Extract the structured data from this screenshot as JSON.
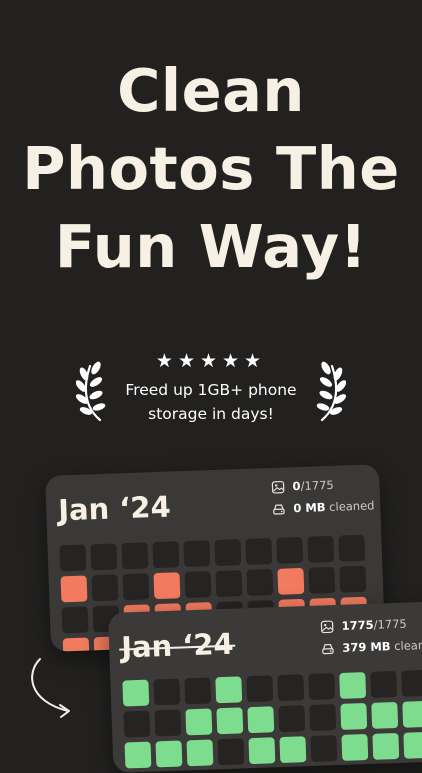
{
  "headline": {
    "line1": "Clean",
    "line2": "Photos The",
    "line3": "Fun Way!"
  },
  "award": {
    "stars": "★★★★★",
    "tagline": "Freed up 1GB+ phone storage in days!",
    "left_icon": "laurel-icon",
    "right_icon": "laurel-icon"
  },
  "card_before": {
    "month": "Jan ‘24",
    "photos_count": "0",
    "photos_total": "/1775",
    "cleaned_value": "0 MB",
    "cleaned_label": "cleaned",
    "grid_active": [
      0,
      0,
      0,
      0,
      0,
      0,
      0,
      0,
      0,
      0,
      1,
      0,
      0,
      1,
      0,
      0,
      0,
      1,
      0,
      0,
      0,
      0,
      1,
      1,
      1,
      0,
      0,
      1,
      1,
      1,
      1,
      1,
      1,
      0,
      1,
      1,
      0,
      1,
      1,
      1
    ],
    "accent": "#f27a5e"
  },
  "card_after": {
    "month": "Jan ‘24",
    "photos_count": "1775",
    "photos_total": "/1775",
    "cleaned_value": "379 MB",
    "cleaned_label": "cleaned",
    "grid_active": [
      1,
      0,
      0,
      1,
      0,
      0,
      0,
      1,
      0,
      0,
      0,
      0,
      1,
      1,
      1,
      0,
      0,
      1,
      1,
      1,
      1,
      1,
      1,
      0,
      1,
      1,
      0,
      1,
      1,
      1,
      1,
      1,
      1,
      1,
      1,
      1,
      1,
      1,
      1,
      1
    ],
    "accent": "#7ddc8e"
  },
  "colors": {
    "background": "#222120",
    "card": "#3a3938",
    "cell_empty": "#252423",
    "text": "#f7f0e4"
  }
}
